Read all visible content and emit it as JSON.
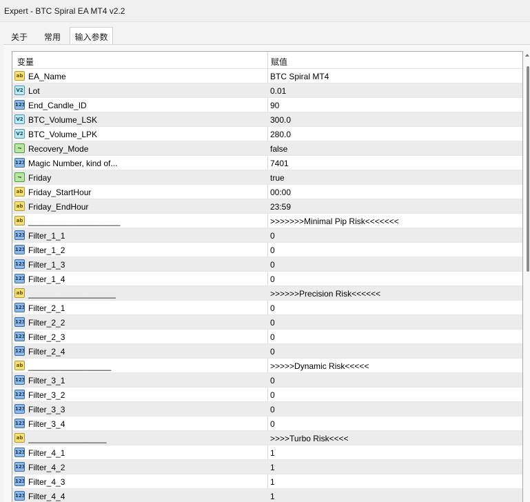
{
  "window": {
    "title": "Expert - BTC Spiral EA MT4 v2.2"
  },
  "tabs": [
    {
      "label": "关于"
    },
    {
      "label": "常用"
    },
    {
      "label": "输入参数",
      "active": true
    }
  ],
  "table": {
    "headers": {
      "variable": "变量",
      "value": "赋值"
    },
    "rows": [
      {
        "icon": "string-icon",
        "type": "str",
        "name": "EA_Name",
        "value": "BTC Spiral MT4"
      },
      {
        "icon": "double-icon",
        "type": "dbl",
        "name": "Lot",
        "value": "0.01"
      },
      {
        "icon": "integer-icon",
        "type": "int",
        "name": "End_Candle_ID",
        "value": "90"
      },
      {
        "icon": "double-icon",
        "type": "dbl",
        "name": "BTC_Volume_LSK",
        "value": "300.0"
      },
      {
        "icon": "double-icon",
        "type": "dbl",
        "name": "BTC_Volume_LPK",
        "value": "280.0"
      },
      {
        "icon": "bool-icon",
        "type": "bool",
        "name": "Recovery_Mode",
        "value": "false"
      },
      {
        "icon": "integer-icon",
        "type": "int",
        "name": "Magic Number, kind of...",
        "value": "7401"
      },
      {
        "icon": "bool-icon",
        "type": "bool",
        "name": "Friday",
        "value": "true"
      },
      {
        "icon": "string-icon",
        "type": "str",
        "name": "Friday_StartHour",
        "value": "00:00"
      },
      {
        "icon": "string-icon",
        "type": "str",
        "name": "Friday_EndHour",
        "value": "23:59"
      },
      {
        "icon": "string-icon",
        "type": "str",
        "name": "____________________",
        "value": ">>>>>>>Minimal Pip Risk<<<<<<<"
      },
      {
        "icon": "integer-icon",
        "type": "int",
        "name": "Filter_1_1",
        "value": "0"
      },
      {
        "icon": "integer-icon",
        "type": "int",
        "name": "Filter_1_2",
        "value": "0"
      },
      {
        "icon": "integer-icon",
        "type": "int",
        "name": "Filter_1_3",
        "value": "0"
      },
      {
        "icon": "integer-icon",
        "type": "int",
        "name": "Filter_1_4",
        "value": "0"
      },
      {
        "icon": "string-icon",
        "type": "str",
        "name": "___________________",
        "value": ">>>>>>Precision Risk<<<<<<"
      },
      {
        "icon": "integer-icon",
        "type": "int",
        "name": "Filter_2_1",
        "value": "0"
      },
      {
        "icon": "integer-icon",
        "type": "int",
        "name": "Filter_2_2",
        "value": "0"
      },
      {
        "icon": "integer-icon",
        "type": "int",
        "name": "Filter_2_3",
        "value": "0"
      },
      {
        "icon": "integer-icon",
        "type": "int",
        "name": "Filter_2_4",
        "value": "0"
      },
      {
        "icon": "string-icon",
        "type": "str",
        "name": "__________________",
        "value": ">>>>>Dynamic Risk<<<<<"
      },
      {
        "icon": "integer-icon",
        "type": "int",
        "name": "Filter_3_1",
        "value": "0"
      },
      {
        "icon": "integer-icon",
        "type": "int",
        "name": "Filter_3_2",
        "value": "0"
      },
      {
        "icon": "integer-icon",
        "type": "int",
        "name": "Filter_3_3",
        "value": "0"
      },
      {
        "icon": "integer-icon",
        "type": "int",
        "name": "Filter_3_4",
        "value": "0"
      },
      {
        "icon": "string-icon",
        "type": "str",
        "name": "_________________",
        "value": ">>>>Turbo Risk<<<<"
      },
      {
        "icon": "integer-icon",
        "type": "int",
        "name": "Filter_4_1",
        "value": "1"
      },
      {
        "icon": "integer-icon",
        "type": "int",
        "name": "Filter_4_2",
        "value": "1"
      },
      {
        "icon": "integer-icon",
        "type": "int",
        "name": "Filter_4_3",
        "value": "1"
      },
      {
        "icon": "integer-icon",
        "type": "int",
        "name": "Filter_4_4",
        "value": "1"
      }
    ]
  },
  "icon_glyphs": {
    "str": "ab",
    "int": "123",
    "dbl": "V2",
    "bool": "⏦"
  }
}
